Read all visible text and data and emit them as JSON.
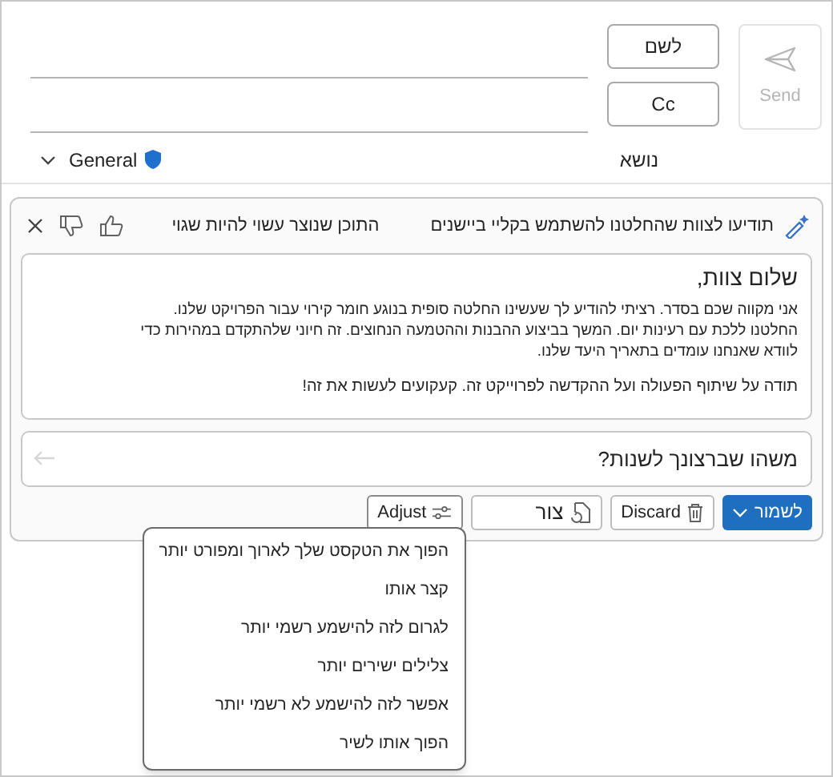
{
  "send_button": {
    "label": "Send",
    "disabled": true
  },
  "recipients": [
    {
      "label": "לשם"
    },
    {
      "label": "Cc"
    }
  ],
  "subject": {
    "label": "נושא",
    "sensitivity": "General"
  },
  "copilot": {
    "prompt": "תודיעו לצוות שהחלטנו להשתמש בקליי ביישנים",
    "disclaimer": "התוכן שנוצר עשוי להיות שגוי",
    "draft": {
      "greeting": "שלום צוות,",
      "body": "אני מקווה שכם בסדר. רציתי להודיע לך שעשינו החלטה סופית בנוגע חומר קירוי עבור הפרויקט שלנו. החלטנו ללכת עם רעינות יום. המשך בביצוע ההבנות וההטמעה הנחוצים. זה חיוני שלהתקדם במהירות כדי לוודא שאנחנו עומדים בתאריך היעד שלנו.",
      "closing": "תודה על שיתוף הפעולה ועל ההקדשה לפרוייקט זה. קעקועים לעשות את זה!"
    },
    "input": {
      "placeholder": "משהו שברצונך לשנות?"
    },
    "actions": [
      {
        "kind": "keep",
        "label": "לשמור"
      },
      {
        "kind": "discard",
        "label": "Discard"
      },
      {
        "kind": "regenerate",
        "label": "צור"
      },
      {
        "kind": "adjust",
        "label": "Adjust",
        "expanded": true
      }
    ]
  },
  "adjust_menu": [
    "הפוך את הטקסט שלך לארוך ומפורט יותר",
    "קצר אותו",
    "לגרום לזה להישמע רשמי יותר",
    "צלילים ישירים יותר",
    "אפשר לזה להישמע לא רשמי יותר",
    "הפוך אותו לשיר"
  ]
}
